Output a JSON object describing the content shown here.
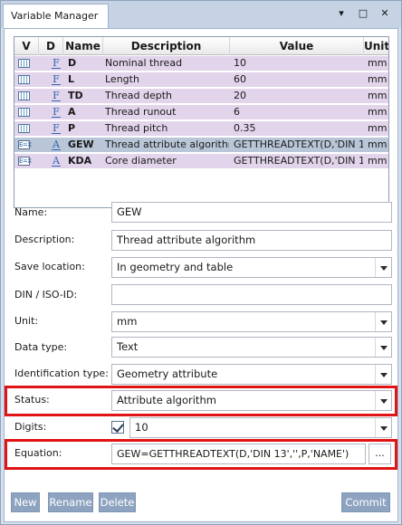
{
  "window": {
    "title": "Variable Manager",
    "menu_icon": "▾",
    "pin_icon": "▪",
    "maximize_icon": "□",
    "close_icon": "✕"
  },
  "grid": {
    "headers": {
      "v": "V",
      "d": "D",
      "name": "Name",
      "description": "Description",
      "value": "Value",
      "unit": "Unit"
    },
    "rows": [
      {
        "v_icon": "table-icon",
        "d_icon": "F",
        "name": "D",
        "description": "Nominal thread",
        "value": "10",
        "unit": "mm"
      },
      {
        "v_icon": "table-icon",
        "d_icon": "F",
        "name": "L",
        "description": "Length",
        "value": "60",
        "unit": "mm"
      },
      {
        "v_icon": "table-icon",
        "d_icon": "F",
        "name": "TD",
        "description": "Thread depth",
        "value": "20",
        "unit": "mm"
      },
      {
        "v_icon": "table-icon",
        "d_icon": "F",
        "name": "A",
        "description": "Thread runout",
        "value": "6",
        "unit": "mm"
      },
      {
        "v_icon": "table-icon",
        "d_icon": "F",
        "name": "P",
        "description": "Thread pitch",
        "value": "0.35",
        "unit": "mm"
      },
      {
        "v_icon": "expression-icon",
        "v_text": "E=X",
        "d_icon": "A",
        "name": "GEW",
        "description": "Thread attribute algorithm",
        "value": "GETTHREADTEXT(D,'DIN 1...",
        "unit": "mm"
      },
      {
        "v_icon": "expression-icon",
        "v_text": "E=X",
        "d_icon": "A",
        "name": "KDA",
        "description": "Core diameter",
        "value": "GETTHREADTEXT(D,'DIN 1...",
        "unit": "mm"
      }
    ]
  },
  "form": {
    "name_label": "Name:",
    "name_value": "GEW",
    "description_label": "Description:",
    "description_value": "Thread attribute algorithm",
    "save_location_label": "Save location:",
    "save_location_value": "In geometry and table",
    "din_label": "DIN / ISO-ID:",
    "din_value": "",
    "unit_label": "Unit:",
    "unit_value": "mm",
    "data_type_label": "Data type:",
    "data_type_value": "Text",
    "identification_type_label": "Identification type:",
    "identification_type_value": "Geometry attribute",
    "status_label": "Status:",
    "status_value": "Attribute algorithm",
    "digits_label": "Digits:",
    "digits_checked": true,
    "digits_value": "10",
    "equation_label": "Equation:",
    "equation_value": "GEW=GETTHREADTEXT(D,'DIN 13','',P,'NAME')",
    "equation_button": "..."
  },
  "buttons": {
    "new": "New",
    "rename": "Rename",
    "delete": "Delete",
    "commit": "Commit"
  },
  "colors": {
    "row_bg": "#e2d4ea",
    "selected_row_bg": "#b9c6d8",
    "highlight": "#e01414",
    "button_bg": "#8ea3c0"
  }
}
